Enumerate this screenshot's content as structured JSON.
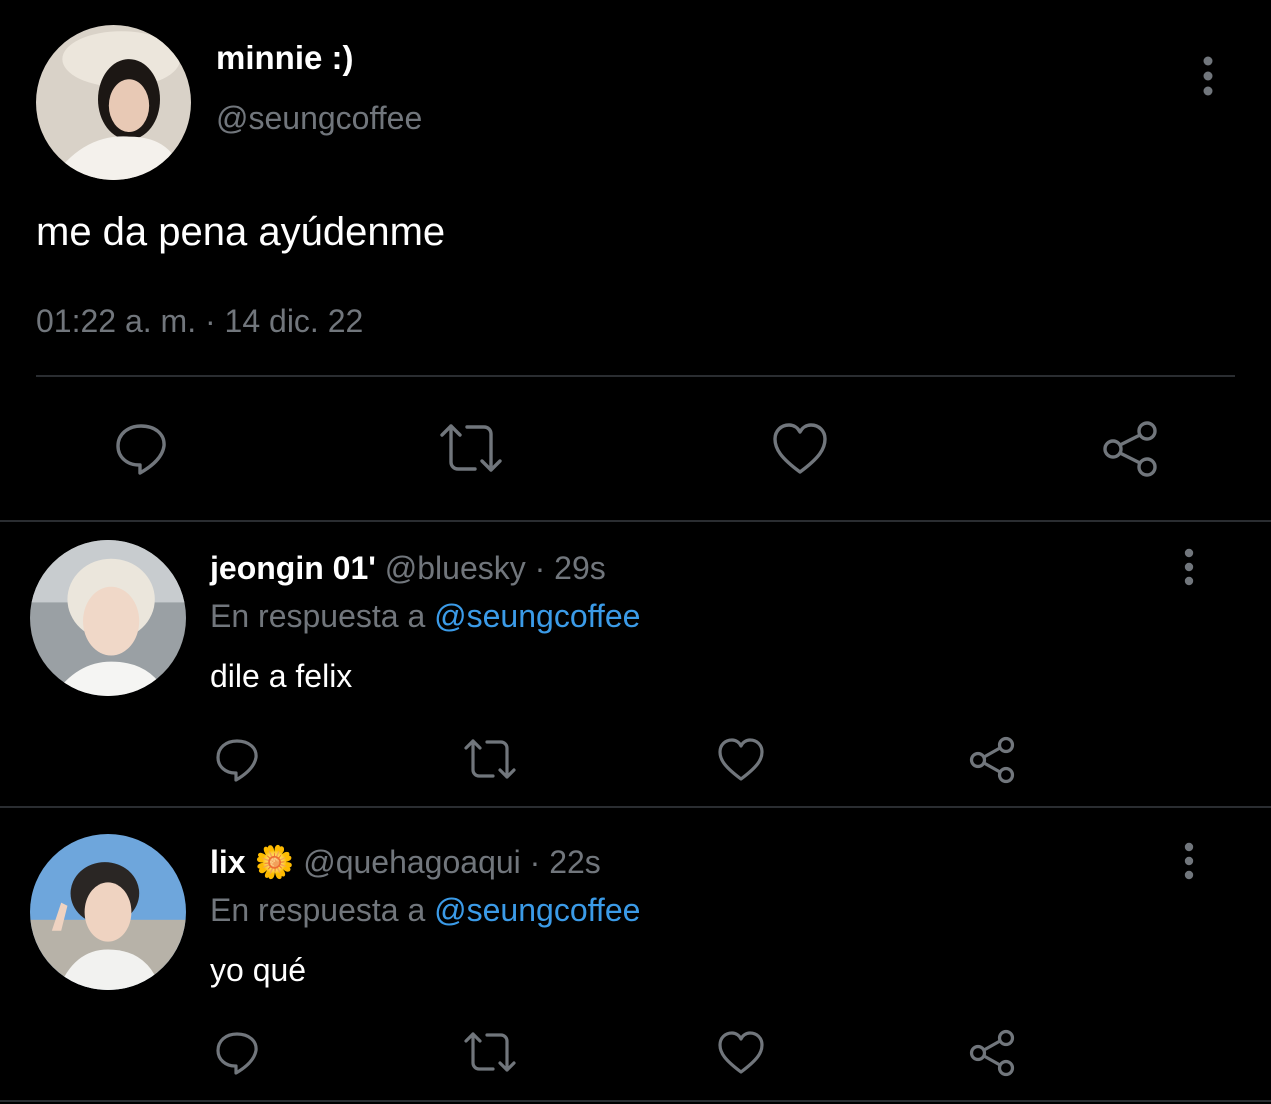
{
  "main_tweet": {
    "display_name": "minnie :)",
    "handle": "@seungcoffee",
    "text": "me da pena ayúdenme",
    "timestamp": "01:22 a. m. · 14 dic. 22"
  },
  "replies": [
    {
      "display_name": "jeongin 01'",
      "handle": "@bluesky",
      "separator": "·",
      "time": "29s",
      "reply_prefix": "En respuesta a",
      "reply_to": "@seungcoffee",
      "text": "dile a felix"
    },
    {
      "display_name": "lix",
      "emoji": "🌼",
      "handle": "@quehagoaqui",
      "separator": "·",
      "time": "22s",
      "reply_prefix": "En respuesta a",
      "reply_to": "@seungcoffee",
      "text": "yo qué"
    }
  ],
  "icons": [
    "more-vert-icon",
    "reply-icon",
    "retweet-icon",
    "like-icon",
    "share-icon"
  ],
  "colors": {
    "background": "#000000",
    "text": "#ffffff",
    "muted": "#71767c",
    "link": "#3b9be8",
    "divider": "#2a2d31"
  }
}
